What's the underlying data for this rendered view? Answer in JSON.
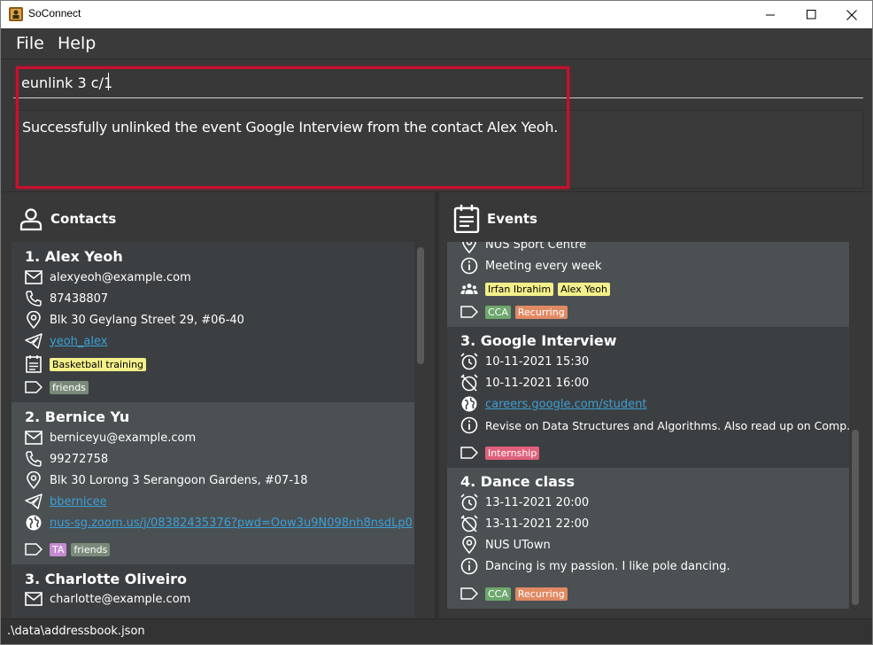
{
  "window": {
    "title": "SoConnect"
  },
  "menu": {
    "file": "File",
    "help": "Help"
  },
  "command": {
    "value": "eunlink 3 c/1"
  },
  "result": {
    "text": "Successfully unlinked the event Google Interview from the contact Alex Yeoh."
  },
  "contacts": {
    "header": "Contacts",
    "items": [
      {
        "title": "1.  Alex Yeoh",
        "email": "alexyeoh@example.com",
        "phone": "87438807",
        "address": "Blk 30 Geylang Street 29, #06-40",
        "telegram": "yeoh_alex",
        "linked_event": "Basketball training",
        "tags": [
          "friends"
        ]
      },
      {
        "title": "2.  Bernice Yu",
        "email": "berniceyu@example.com",
        "phone": "99272758",
        "address": "Blk 30 Lorong 3 Serangoon Gardens, #07-18",
        "telegram": "bbernicee",
        "zoom": "nus-sg.zoom.us/j/08382435376?pwd=Oow3u9N098nh8nsdLp0",
        "tags": [
          "TA",
          "friends"
        ]
      },
      {
        "title": "3.  Charlotte Oliveiro",
        "email": "charlotte@example.com"
      }
    ]
  },
  "events": {
    "header": "Events",
    "items": [
      {
        "address": "NUS Sport Centre",
        "description": "Meeting every week",
        "participants": [
          "Irfan Ibrahim",
          "Alex Yeoh"
        ],
        "tags": [
          "CCA",
          "Recurring"
        ]
      },
      {
        "title": "3.  Google Interview",
        "start": "10-11-2021 15:30",
        "end": "10-11-2021 16:00",
        "zoom": "careers.google.com/student",
        "description": "Revise on Data Structures and Algorithms. Also read up on Comp...",
        "tags": [
          "Internship"
        ]
      },
      {
        "title": "4.  Dance class",
        "start": "13-11-2021 20:00",
        "end": "13-11-2021 22:00",
        "address": "NUS UTown",
        "description": "Dancing is my passion. I like pole dancing.",
        "tags": [
          "CCA",
          "Recurring"
        ]
      }
    ]
  },
  "status": {
    "path": ".\\data\\addressbook.json"
  },
  "colors": {
    "highlight": "#c8102e",
    "link": "#3b9fd6",
    "background": "#383838"
  }
}
